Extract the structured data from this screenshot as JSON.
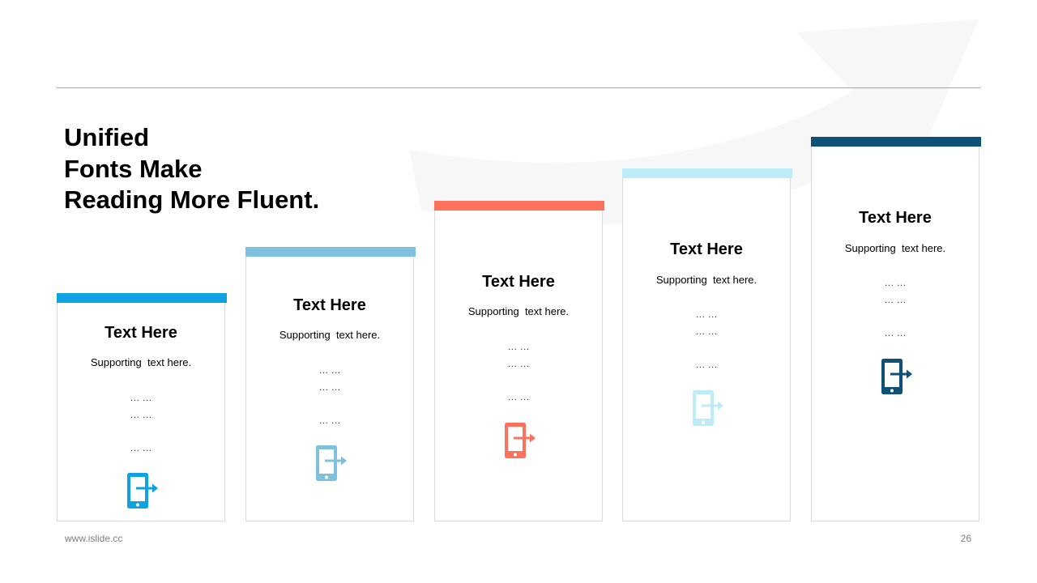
{
  "slide": {
    "title_lines": [
      "Unified",
      "Fonts Make",
      "Reading More Fluent."
    ],
    "footer_url": "www.islide.cc",
    "page_number": "26"
  },
  "cards": [
    {
      "heading": "Text Here",
      "supporting": "Supporting  text here.",
      "dots": [
        "… …",
        "… …",
        "… …"
      ],
      "accent_color": "#0ea2e2",
      "icon": "phone-arrow-icon"
    },
    {
      "heading": "Text Here",
      "supporting": "Supporting  text here.",
      "dots": [
        "… …",
        "… …",
        "… …"
      ],
      "accent_color": "#7fc0de",
      "icon": "phone-arrow-icon"
    },
    {
      "heading": "Text Here",
      "supporting": "Supporting  text here.",
      "dots": [
        "… …",
        "… …",
        "… …"
      ],
      "accent_color": "#fd725c",
      "icon": "phone-arrow-icon"
    },
    {
      "heading": "Text Here",
      "supporting": "Supporting  text here.",
      "dots": [
        "… …",
        "… …",
        "… …"
      ],
      "accent_color": "#bdebf7",
      "icon": "phone-arrow-icon"
    },
    {
      "heading": "Text Here",
      "supporting": "Supporting  text here.",
      "dots": [
        "… …",
        "… …",
        "… …"
      ],
      "accent_color": "#0d5177",
      "icon": "phone-arrow-icon"
    }
  ]
}
